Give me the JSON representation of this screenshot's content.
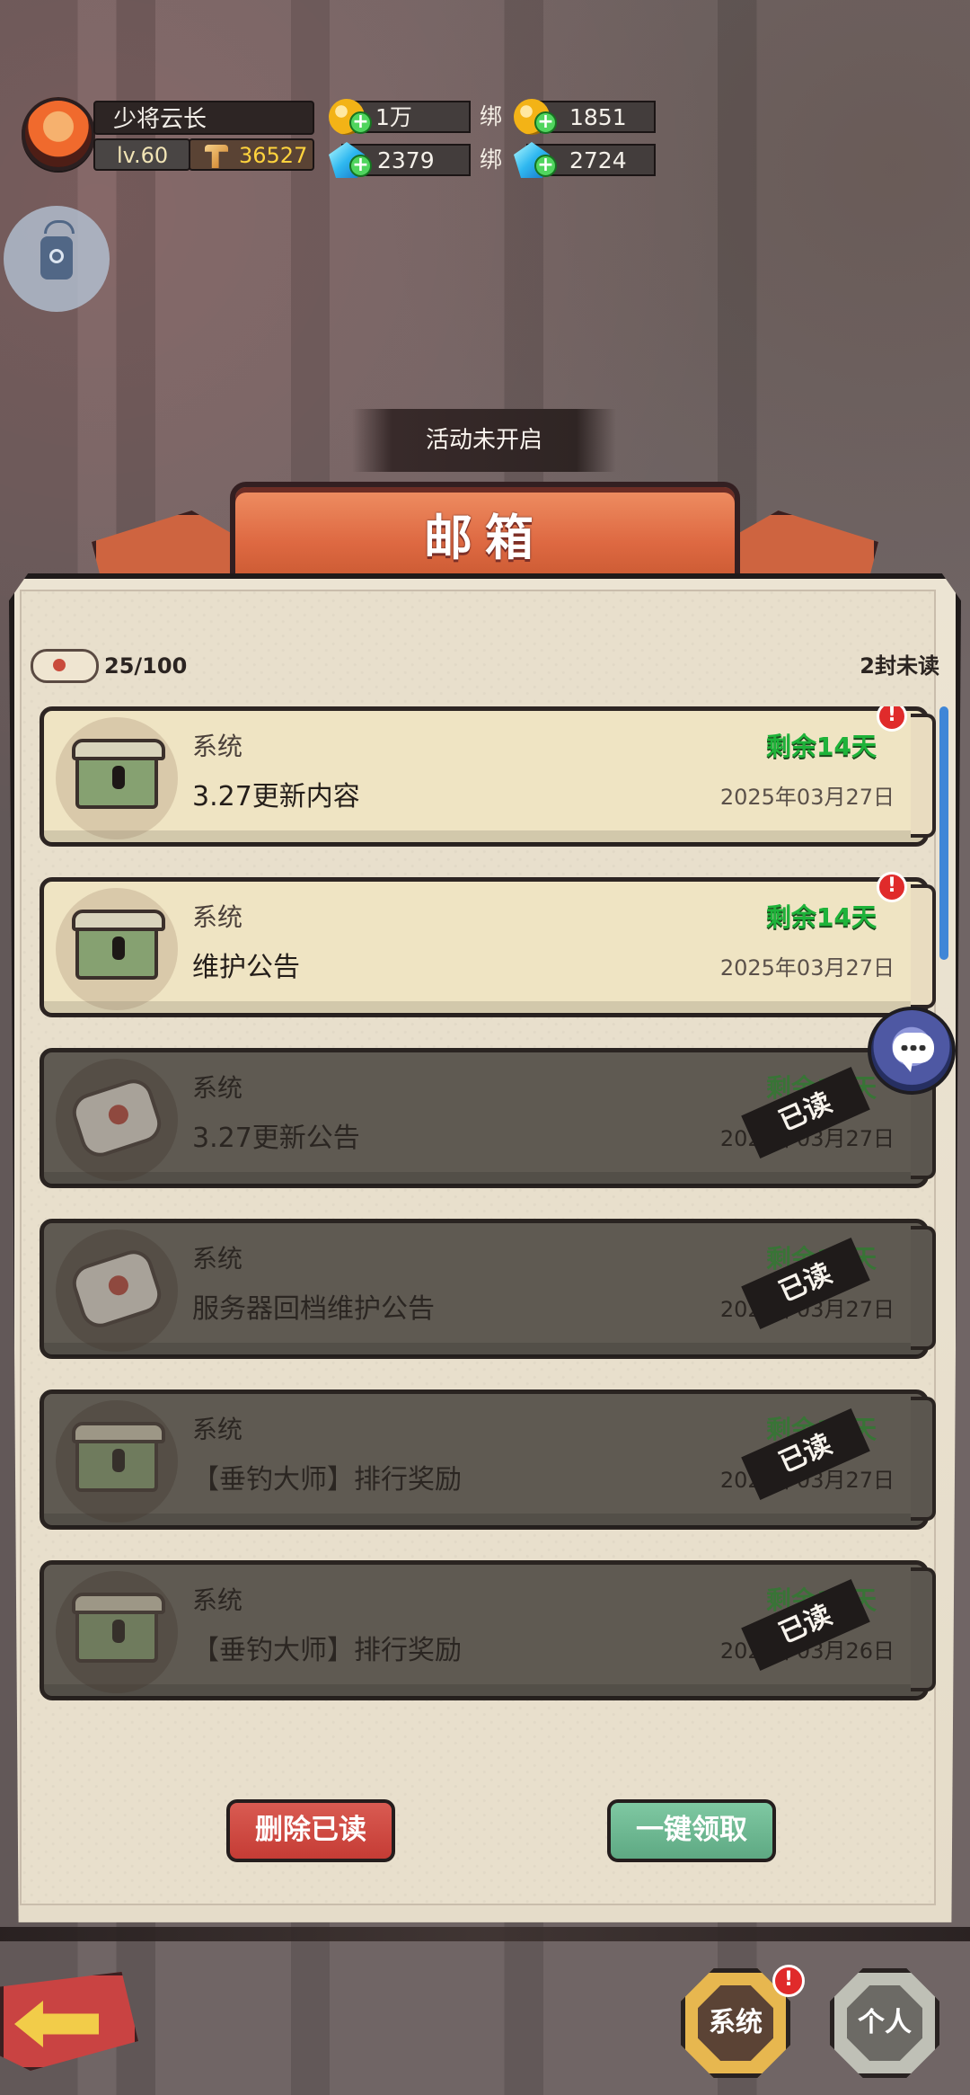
{
  "header": {
    "player_name": "少将云长",
    "level": "lv.60",
    "power": "36527",
    "resources": [
      {
        "label": "1万",
        "type": "gold",
        "bound": false
      },
      {
        "label": "1851",
        "type": "gold",
        "bound": true,
        "bound_label": "绑"
      },
      {
        "label": "2379",
        "type": "gem",
        "bound": false
      },
      {
        "label": "2724",
        "type": "gem",
        "bound": true,
        "bound_label": "绑"
      }
    ]
  },
  "notice": "活动未开启",
  "title": "邮箱",
  "mailbox": {
    "count": "25/100",
    "unread": "2封未读"
  },
  "mails": [
    {
      "sender": "系统",
      "subject": "3.27更新内容",
      "remain": "剩余14天",
      "date": "2025年03月27日",
      "read": false,
      "icon": "chest-icon",
      "alert": "!"
    },
    {
      "sender": "系统",
      "subject": "维护公告",
      "remain": "剩余14天",
      "date": "2025年03月27日",
      "read": false,
      "icon": "chest-icon",
      "alert": "!"
    },
    {
      "sender": "系统",
      "subject": "3.27更新公告",
      "remain": "剩余14天",
      "date": "2025年03月27日",
      "read": true,
      "icon": "scroll-icon",
      "read_mark": "已读"
    },
    {
      "sender": "系统",
      "subject": "服务器回档维护公告",
      "remain": "剩余14天",
      "date": "2025年03月27日",
      "read": true,
      "icon": "scroll-icon",
      "read_mark": "已读"
    },
    {
      "sender": "系统",
      "subject": "【垂钓大师】排行奖励",
      "remain": "剩余14天",
      "date": "2025年03月27日",
      "read": true,
      "icon": "chest-icon",
      "read_mark": "已读"
    },
    {
      "sender": "系统",
      "subject": "【垂钓大师】排行奖励",
      "remain": "剩余13天",
      "date": "2025年03月26日",
      "read": true,
      "icon": "chest-icon",
      "read_mark": "已读"
    }
  ],
  "buttons": {
    "delete_read": "删除已读",
    "collect_all": "一键领取"
  },
  "tabs": {
    "system": "系统",
    "personal": "个人",
    "system_alert": "!"
  },
  "colors": {
    "accent_orange": "#de6942",
    "green_remaining": "#1eb33a",
    "alert_red": "#e02b2b"
  }
}
